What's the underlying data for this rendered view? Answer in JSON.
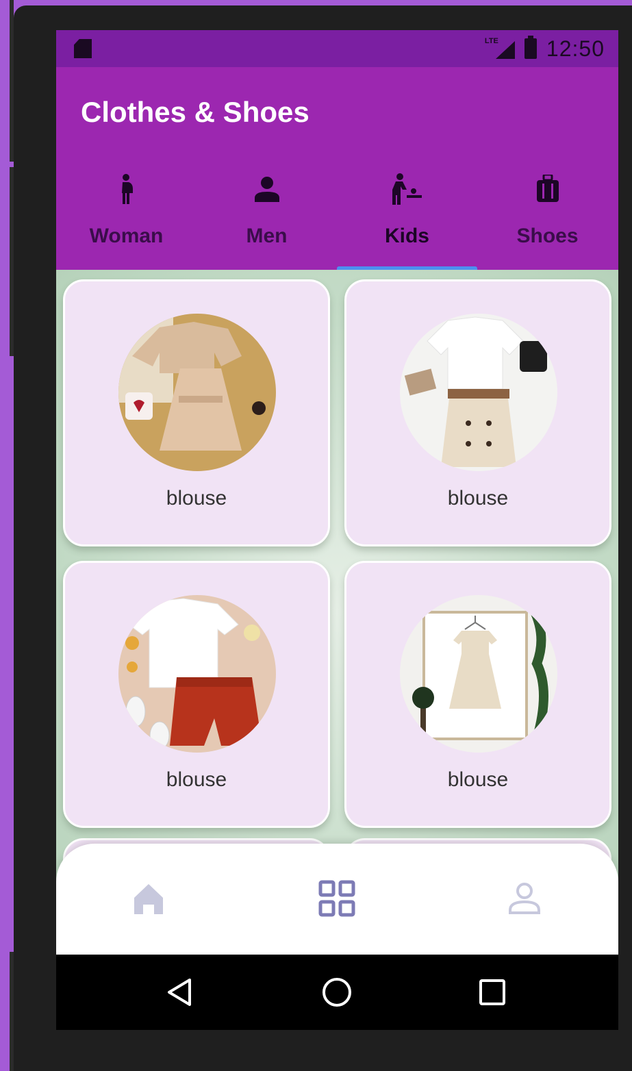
{
  "status_bar": {
    "time": "12:50",
    "network": "LTE"
  },
  "app_bar": {
    "title": "Clothes & Shoes",
    "color": "#9c27b0"
  },
  "tabs": [
    {
      "label": "Woman",
      "icon": "pregnant-woman-icon",
      "active": false
    },
    {
      "label": "Men",
      "icon": "person-icon",
      "active": false
    },
    {
      "label": "Kids",
      "icon": "baby-changing-icon",
      "active": true
    },
    {
      "label": "Shoes",
      "icon": "luggage-icon",
      "active": false
    }
  ],
  "accent_color": "#4d8ff0",
  "products": [
    {
      "caption": "blouse",
      "image": "beige-jacket-dress-outfit"
    },
    {
      "caption": "blouse",
      "image": "white-shirt-beige-skirt-outfit"
    },
    {
      "caption": "blouse",
      "image": "white-blouse-red-shorts-outfit"
    },
    {
      "caption": "blouse",
      "image": "beige-dress-on-hanger"
    }
  ],
  "bottom_nav": [
    {
      "icon": "home-icon",
      "active": false
    },
    {
      "icon": "grid-icon",
      "active": true
    },
    {
      "icon": "profile-icon",
      "active": false
    }
  ],
  "system_nav": [
    "back-icon",
    "home-circle-icon",
    "recents-icon"
  ]
}
